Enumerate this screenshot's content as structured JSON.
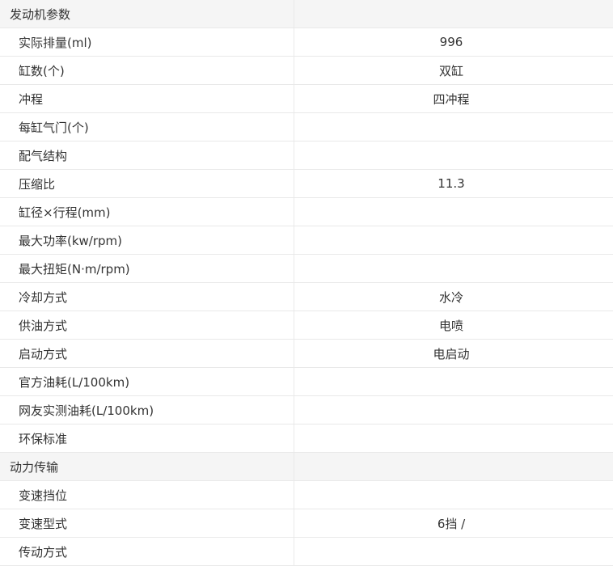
{
  "sections": [
    {
      "title": "发动机参数",
      "rows": [
        {
          "label": "实际排量(ml)",
          "value": "996"
        },
        {
          "label": "缸数(个)",
          "value": "双缸"
        },
        {
          "label": "冲程",
          "value": "四冲程"
        },
        {
          "label": "每缸气门(个)",
          "value": ""
        },
        {
          "label": "配气结构",
          "value": ""
        },
        {
          "label": "压缩比",
          "value": "11.3"
        },
        {
          "label": "缸径×行程(mm)",
          "value": ""
        },
        {
          "label": "最大功率(kw/rpm)",
          "value": ""
        },
        {
          "label": "最大扭矩(N·m/rpm)",
          "value": ""
        },
        {
          "label": "冷却方式",
          "value": "水冷"
        },
        {
          "label": "供油方式",
          "value": "电喷"
        },
        {
          "label": "启动方式",
          "value": "电启动"
        },
        {
          "label": "官方油耗(L/100km)",
          "value": ""
        },
        {
          "label": "网友实测油耗(L/100km)",
          "value": ""
        },
        {
          "label": "环保标准",
          "value": ""
        }
      ]
    },
    {
      "title": "动力传输",
      "rows": [
        {
          "label": "变速挡位",
          "value": ""
        },
        {
          "label": "变速型式",
          "value": "6挡 /"
        },
        {
          "label": "传动方式",
          "value": ""
        }
      ]
    }
  ]
}
